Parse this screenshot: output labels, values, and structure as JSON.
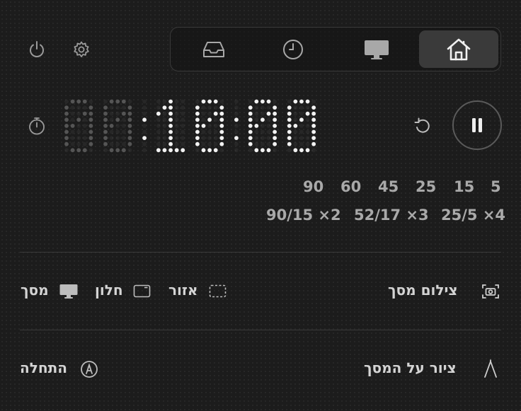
{
  "toolbar": {
    "power_icon": "power-icon",
    "settings_icon": "gear-icon"
  },
  "tabs": [
    {
      "name": "inbox",
      "icon": "inbox-icon",
      "active": false
    },
    {
      "name": "history",
      "icon": "clock-icon",
      "active": false
    },
    {
      "name": "display",
      "icon": "display-icon",
      "active": false
    },
    {
      "name": "home",
      "icon": "home-icon",
      "active": true
    }
  ],
  "timer": {
    "display": "00:10:00",
    "dim_digits": 2,
    "state": "running"
  },
  "presets": {
    "minutes": [
      "90",
      "60",
      "45",
      "25",
      "15",
      "5"
    ],
    "intervals": [
      "90/15 ×2",
      "52/17 ×3",
      "25/5 ×4"
    ]
  },
  "capture": {
    "title": "צילום מסך",
    "options": [
      {
        "label": "אזור",
        "icon": "dashed-rect-icon"
      },
      {
        "label": "חלון",
        "icon": "window-icon"
      },
      {
        "label": "מסך",
        "icon": "monitor-icon"
      }
    ]
  },
  "draw": {
    "title": "ציור על המסך",
    "start_label": "התחלה"
  },
  "colors": {
    "background": "#1c1c1c",
    "lit_dot": "#f2f2f2",
    "dim_dot": "#555555",
    "accent_tab": "#3a3a3a"
  }
}
